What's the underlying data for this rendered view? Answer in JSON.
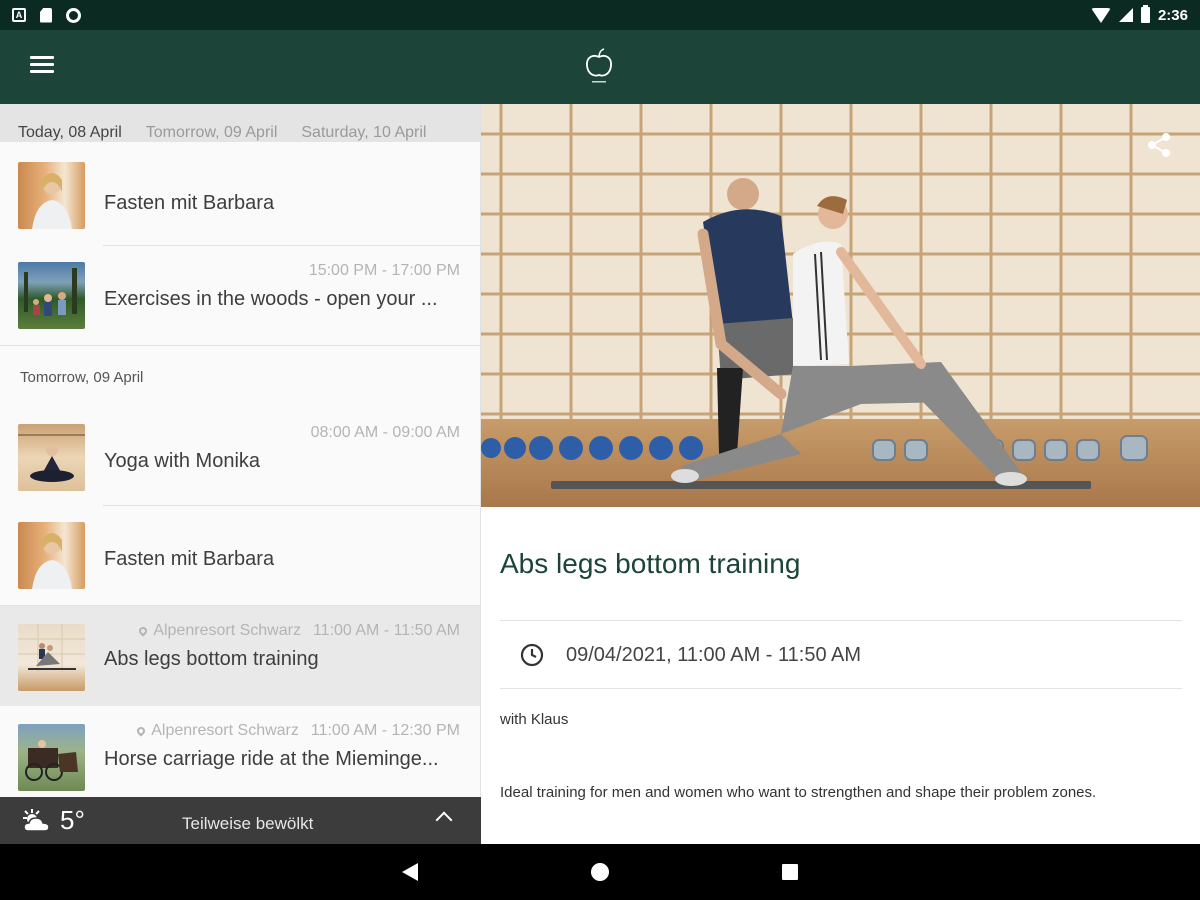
{
  "status_bar": {
    "time": "2:36"
  },
  "day_tabs": [
    "Today, 08 April",
    "Tomorrow, 09 April",
    "Saturday, 10 April"
  ],
  "today_items": [
    {
      "time": "",
      "location": "",
      "title": "Fasten mit Barbara"
    },
    {
      "time": "15:00 PM - 17:00 PM",
      "location": "",
      "title": "Exercises in the woods - open your ..."
    }
  ],
  "tomorrow_header": "Tomorrow, 09 April",
  "tomorrow_items": [
    {
      "time": "08:00 AM - 09:00 AM",
      "location": "",
      "title": "Yoga with Monika"
    },
    {
      "time": "",
      "location": "",
      "title": "Fasten mit Barbara"
    },
    {
      "time": "11:00 AM - 11:50 AM",
      "location": "Alpenresort Schwarz",
      "title": "Abs legs bottom training"
    },
    {
      "time": "11:00 AM - 12:30 PM",
      "location": "Alpenresort Schwarz",
      "title": "Horse carriage ride at the Mieminge..."
    }
  ],
  "weather": {
    "temperature": "5°",
    "condition": "Teilweise bewölkt"
  },
  "detail": {
    "title": "Abs legs bottom training",
    "datetime": "09/04/2021, 11:00 AM - 11:50 AM",
    "trainer": "with Klaus",
    "description": "Ideal training for men and women who want to strengthen and shape their problem zones."
  }
}
